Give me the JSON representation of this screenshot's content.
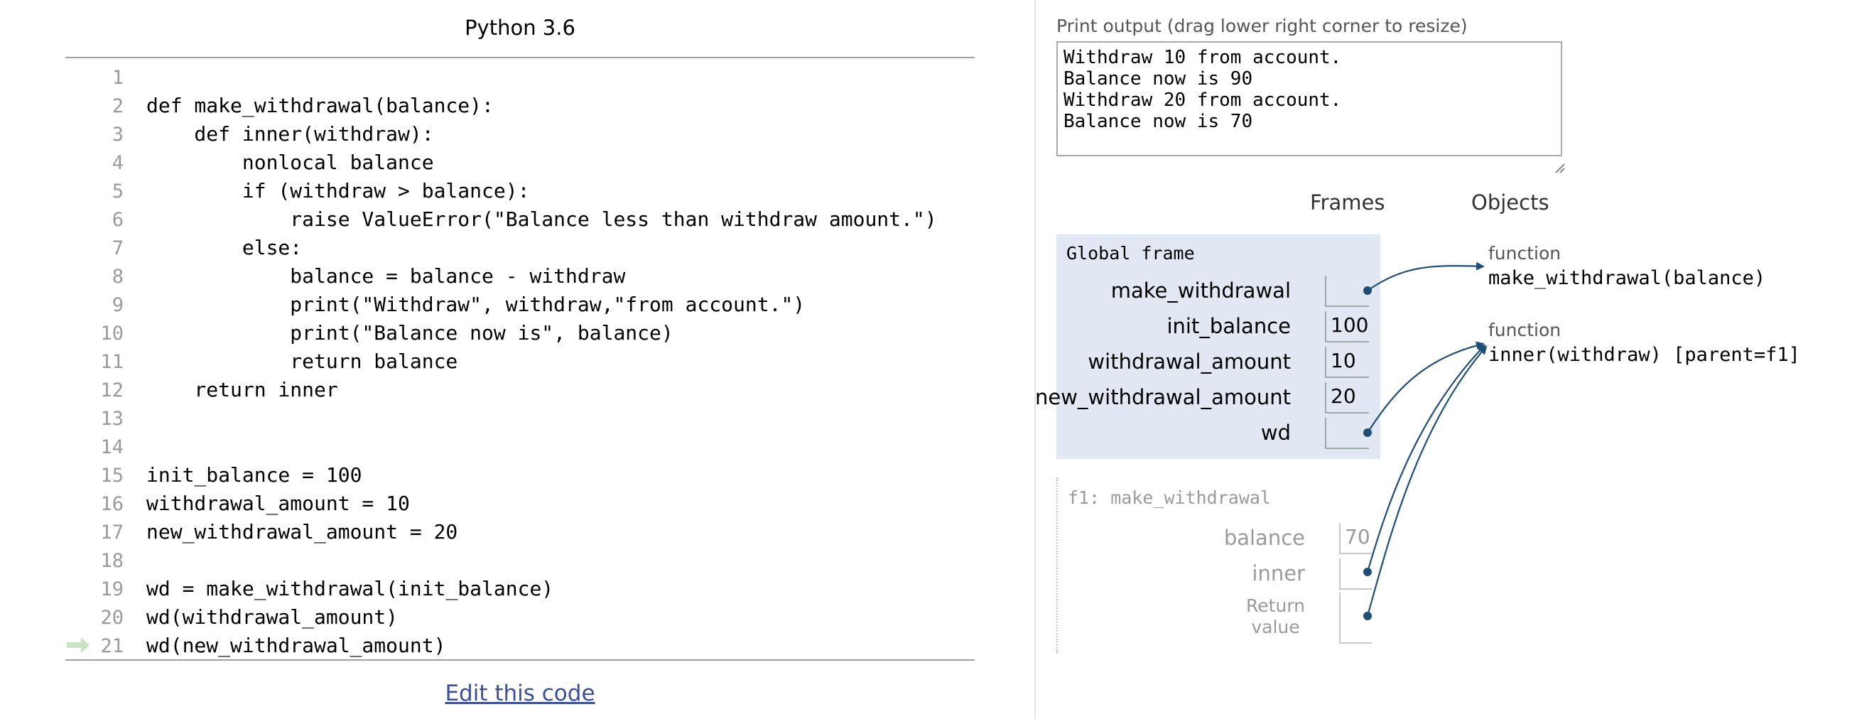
{
  "code_panel": {
    "language": "Python 3.6",
    "lines": [
      {
        "num": "1",
        "code": ""
      },
      {
        "num": "2",
        "code": "def make_withdrawal(balance):"
      },
      {
        "num": "3",
        "code": "    def inner(withdraw):"
      },
      {
        "num": "4",
        "code": "        nonlocal balance"
      },
      {
        "num": "5",
        "code": "        if (withdraw > balance):"
      },
      {
        "num": "6",
        "code": "            raise ValueError(\"Balance less than withdraw amount.\")"
      },
      {
        "num": "7",
        "code": "        else:"
      },
      {
        "num": "8",
        "code": "            balance = balance - withdraw"
      },
      {
        "num": "9",
        "code": "            print(\"Withdraw\", withdraw,\"from account.\")"
      },
      {
        "num": "10",
        "code": "            print(\"Balance now is\", balance)"
      },
      {
        "num": "11",
        "code": "            return balance"
      },
      {
        "num": "12",
        "code": "    return inner"
      },
      {
        "num": "13",
        "code": ""
      },
      {
        "num": "14",
        "code": ""
      },
      {
        "num": "15",
        "code": "init_balance = 100"
      },
      {
        "num": "16",
        "code": "withdrawal_amount = 10"
      },
      {
        "num": "17",
        "code": "new_withdrawal_amount = 20"
      },
      {
        "num": "18",
        "code": ""
      },
      {
        "num": "19",
        "code": "wd = make_withdrawal(init_balance)"
      },
      {
        "num": "20",
        "code": "wd(withdrawal_amount)"
      },
      {
        "num": "21",
        "code": "wd(new_withdrawal_amount)"
      }
    ],
    "current_line": "21",
    "edit_link": "Edit this code"
  },
  "output": {
    "label": "Print output (drag lower right corner to resize)",
    "lines": [
      "Withdraw 10 from account.",
      "Balance now is 90",
      "Withdraw 20 from account.",
      "Balance now is 70"
    ]
  },
  "viz": {
    "frames_header": "Frames",
    "objects_header": "Objects",
    "global_frame": {
      "title": "Global frame",
      "vars": [
        {
          "name": "make_withdrawal",
          "value": ""
        },
        {
          "name": "init_balance",
          "value": "100"
        },
        {
          "name": "withdrawal_amount",
          "value": "10"
        },
        {
          "name": "new_withdrawal_amount",
          "value": "20"
        },
        {
          "name": "wd",
          "value": ""
        }
      ]
    },
    "f1_frame": {
      "title": "f1: make_withdrawal",
      "vars": [
        {
          "name": "balance",
          "value": "70"
        },
        {
          "name": "inner",
          "value": ""
        },
        {
          "name": "return_line1",
          "value": "Return"
        },
        {
          "name": "return_line2",
          "value": "value"
        }
      ]
    },
    "objects": [
      {
        "type": "function",
        "value": "make_withdrawal(balance)"
      },
      {
        "type": "function",
        "value": "inner(withdraw) [parent=f1]"
      }
    ],
    "colors": {
      "arrow": "#1f4e79",
      "frame_bg": "#e2e8f3",
      "current_line_arrow": "#c9e3c4"
    }
  }
}
